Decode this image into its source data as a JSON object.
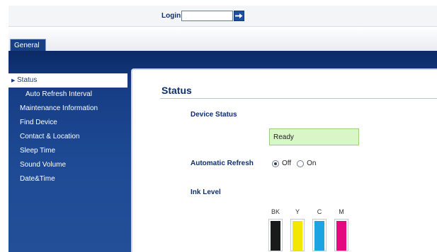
{
  "login": {
    "label": "Login",
    "value": ""
  },
  "tabs": [
    {
      "label": "General"
    }
  ],
  "sidebar": {
    "items": [
      {
        "label": "Status",
        "active": true,
        "sub": false
      },
      {
        "label": "Auto Refresh Interval",
        "active": false,
        "sub": true
      },
      {
        "label": "Maintenance Information",
        "active": false,
        "sub": false
      },
      {
        "label": "Find Device",
        "active": false,
        "sub": false
      },
      {
        "label": "Contact & Location",
        "active": false,
        "sub": false
      },
      {
        "label": "Sleep Time",
        "active": false,
        "sub": false
      },
      {
        "label": "Sound Volume",
        "active": false,
        "sub": false
      },
      {
        "label": "Date&Time",
        "active": false,
        "sub": false
      }
    ]
  },
  "main": {
    "title": "Status",
    "device_status": {
      "label": "Device Status",
      "value": "Ready"
    },
    "auto_refresh": {
      "label": "Automatic Refresh",
      "options": [
        "Off",
        "On"
      ],
      "selected": "Off"
    },
    "ink": {
      "label": "Ink Level",
      "cartridges": [
        {
          "name": "BK",
          "level": 0.95,
          "color": "#1a1a1a"
        },
        {
          "name": "Y",
          "level": 0.95,
          "color": "#f3e600"
        },
        {
          "name": "C",
          "level": 0.95,
          "color": "#1aa4e0"
        },
        {
          "name": "M",
          "level": 0.95,
          "color": "#e5097f"
        }
      ]
    }
  },
  "colors": {
    "brand_navy": "#0e2f6c",
    "status_green": "#d9f7c6"
  },
  "icons": {
    "login_go": "arrow-right-icon",
    "active_marker": "triangle-right-icon"
  }
}
